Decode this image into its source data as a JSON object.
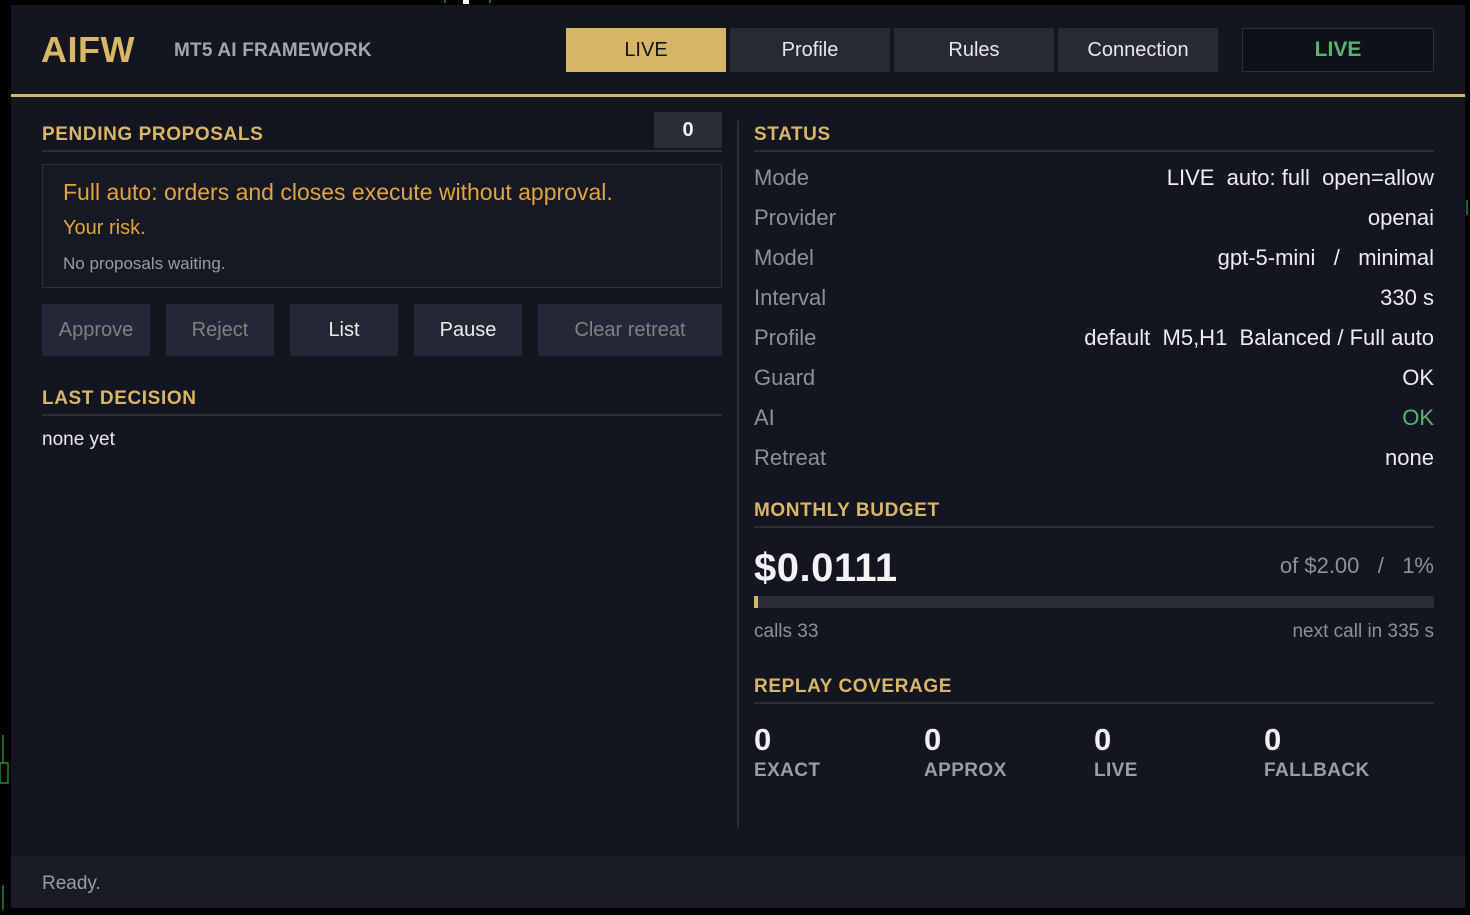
{
  "header": {
    "logo": "AIFW",
    "subtitle": "MT5 AI FRAMEWORK",
    "tabs": [
      {
        "label": "LIVE",
        "active": true
      },
      {
        "label": "Profile",
        "active": false
      },
      {
        "label": "Rules",
        "active": false
      },
      {
        "label": "Connection",
        "active": false
      }
    ],
    "indicator": "LIVE"
  },
  "pending": {
    "title": "PENDING PROPOSALS",
    "count": "0",
    "notice_line1": "Full auto: orders and closes execute without approval.",
    "notice_line2": "Your risk.",
    "notice_line3": "No proposals waiting.",
    "buttons": {
      "approve": "Approve",
      "reject": "Reject",
      "list": "List",
      "pause": "Pause",
      "clear_retreat": "Clear retreat"
    }
  },
  "last_decision": {
    "title": "LAST DECISION",
    "value": "none yet"
  },
  "status": {
    "title": "STATUS",
    "rows": [
      {
        "label": "Mode",
        "value": "LIVE  auto: full  open=allow"
      },
      {
        "label": "Provider",
        "value": "openai"
      },
      {
        "label": "Model",
        "value": "gpt-5-mini   /   minimal"
      },
      {
        "label": "Interval",
        "value": "330 s"
      },
      {
        "label": "Profile",
        "value": "default  M5,H1  Balanced / Full auto"
      },
      {
        "label": "Guard",
        "value": "OK"
      },
      {
        "label": "AI",
        "value": "OK"
      },
      {
        "label": "Retreat",
        "value": "none"
      }
    ]
  },
  "budget": {
    "title": "MONTHLY BUDGET",
    "amount": "$0.0111",
    "of_text": "of $2.00   /   1%",
    "used_fraction": 0.0055,
    "calls": "calls 33",
    "next_call": "next call in 335 s"
  },
  "replay": {
    "title": "REPLAY COVERAGE",
    "items": [
      {
        "value": "0",
        "label": "EXACT"
      },
      {
        "value": "0",
        "label": "APPROX"
      },
      {
        "value": "0",
        "label": "LIVE"
      },
      {
        "value": "0",
        "label": "FALLBACK"
      }
    ]
  },
  "footer": {
    "status": "Ready."
  },
  "colors": {
    "accent": "#d6b566",
    "ok_green": "#58b56e",
    "warning": "#e3a43e",
    "panel_bg": "#131520"
  }
}
